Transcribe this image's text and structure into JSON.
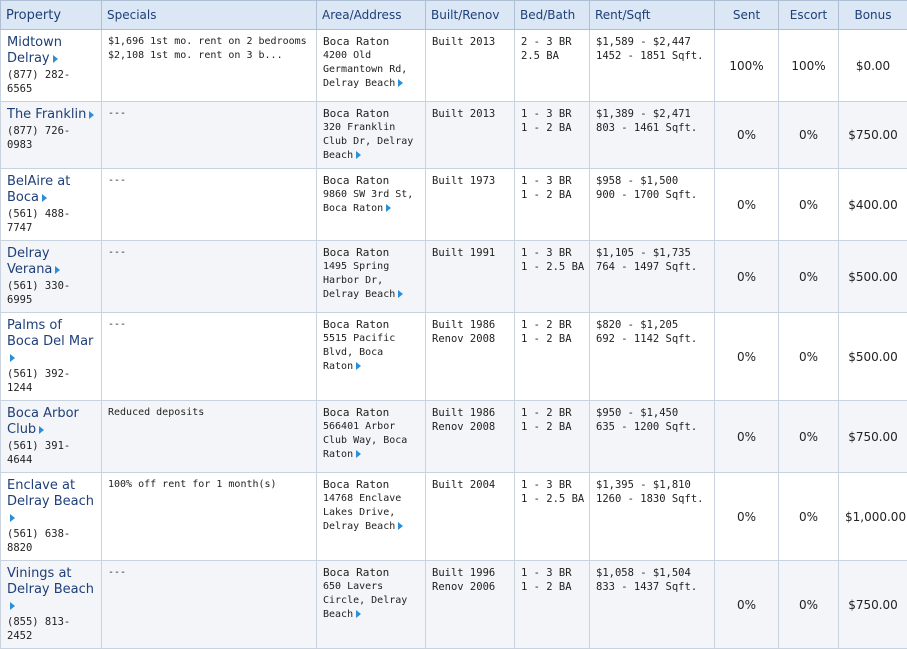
{
  "headers": {
    "property": "Property",
    "specials": "Specials",
    "area": "Area/Address",
    "built": "Built/Renov",
    "bed": "Bed/Bath",
    "rent": "Rent/Sqft",
    "sent": "Sent",
    "escort": "Escort",
    "bonus": "Bonus"
  },
  "rows": [
    {
      "name": "Midtown Delray",
      "phone": "(877) 282-6565",
      "specials": "$1,696 1st mo. rent on 2 bedrooms $2,108 1st mo. rent on 3 b...",
      "city": "Boca Raton",
      "address": "4200 Old Germantown Rd, Delray Beach",
      "built": "Built 2013",
      "renov": "",
      "bed": "2 - 3 BR",
      "bath": "2.5 BA",
      "rent": "$1,589 - $2,447",
      "sqft": "1452 - 1851 Sqft.",
      "sent": "100%",
      "escort": "100%",
      "bonus": "$0.00"
    },
    {
      "name": "The Franklin",
      "phone": "(877) 726-0983",
      "specials": "---",
      "city": "Boca Raton",
      "address": "320 Franklin Club Dr, Delray Beach",
      "built": "Built 2013",
      "renov": "",
      "bed": "1 - 3 BR",
      "bath": "1 - 2 BA",
      "rent": "$1,389 - $2,471",
      "sqft": "803 - 1461 Sqft.",
      "sent": "0%",
      "escort": "0%",
      "bonus": "$750.00"
    },
    {
      "name": "BelAire at Boca",
      "phone": "(561) 488-7747",
      "specials": "---",
      "city": "Boca Raton",
      "address": "9860 SW 3rd St, Boca Raton",
      "built": "Built 1973",
      "renov": "",
      "bed": "1 - 3 BR",
      "bath": "1 - 2 BA",
      "rent": "$958 - $1,500",
      "sqft": "900 - 1700 Sqft.",
      "sent": "0%",
      "escort": "0%",
      "bonus": "$400.00"
    },
    {
      "name": "Delray Verana",
      "phone": "(561) 330-6995",
      "specials": "---",
      "city": "Boca Raton",
      "address": "1495 Spring Harbor Dr, Delray Beach",
      "built": "Built 1991",
      "renov": "",
      "bed": "1 - 3 BR",
      "bath": "1 - 2.5 BA",
      "rent": "$1,105 - $1,735",
      "sqft": "764 - 1497 Sqft.",
      "sent": "0%",
      "escort": "0%",
      "bonus": "$500.00"
    },
    {
      "name": "Palms of Boca Del Mar",
      "phone": "(561) 392-1244",
      "specials": "---",
      "city": "Boca Raton",
      "address": "5515 Pacific Blvd, Boca Raton",
      "built": "Built 1986",
      "renov": "Renov 2008",
      "bed": "1 - 2 BR",
      "bath": "1 - 2 BA",
      "rent": "$820 - $1,205",
      "sqft": "692 - 1142 Sqft.",
      "sent": "0%",
      "escort": "0%",
      "bonus": "$500.00"
    },
    {
      "name": "Boca Arbor Club",
      "phone": "(561) 391-4644",
      "specials": "Reduced deposits",
      "city": "Boca Raton",
      "address": "566401 Arbor Club Way, Boca Raton",
      "built": "Built 1986",
      "renov": "Renov 2008",
      "bed": "1 - 2 BR",
      "bath": "1 - 2 BA",
      "rent": "$950 - $1,450",
      "sqft": "635 - 1200 Sqft.",
      "sent": "0%",
      "escort": "0%",
      "bonus": "$750.00"
    },
    {
      "name": "Enclave at Delray Beach",
      "phone": "(561) 638-8820",
      "specials": "100% off rent for 1 month(s)",
      "city": "Boca Raton",
      "address": "14768 Enclave Lakes Drive, Delray Beach",
      "built": "Built 2004",
      "renov": "",
      "bed": "1 - 3 BR",
      "bath": "1 - 2.5 BA",
      "rent": "$1,395 - $1,810",
      "sqft": "1260 - 1830 Sqft.",
      "sent": "0%",
      "escort": "0%",
      "bonus": "$1,000.00"
    },
    {
      "name": "Vinings at Delray Beach",
      "phone": "(855) 813-2452",
      "specials": "---",
      "city": "Boca Raton",
      "address": "650 Lavers Circle, Delray Beach",
      "built": "Built 1996",
      "renov": "Renov 2006",
      "bed": "1 - 3 BR",
      "bath": "1 - 2 BA",
      "rent": "$1,058 - $1,504",
      "sqft": "833 - 1437 Sqft.",
      "sent": "0%",
      "escort": "0%",
      "bonus": "$750.00"
    }
  ]
}
